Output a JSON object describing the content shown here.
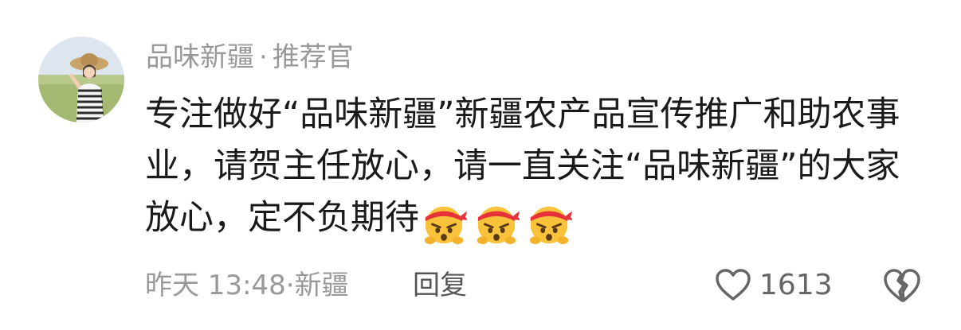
{
  "comment": {
    "author_name": "品味新疆",
    "author_separator": "·",
    "author_role": "推荐官",
    "text": "专注做好“品味新疆”新疆农产品宣传推广和助农事业，请贺主任放心，请一直关注“品味新疆”的大家放心，定不负期待",
    "emojis": [
      "determined-face-emoji",
      "determined-face-emoji",
      "determined-face-emoji"
    ],
    "time": "昨天 13:48",
    "meta_separator": "·",
    "location": "新疆",
    "reply_label": "回复",
    "like_count": "1613",
    "like_icon": "heart-outline-icon",
    "dislike_icon": "broken-heart-icon"
  }
}
